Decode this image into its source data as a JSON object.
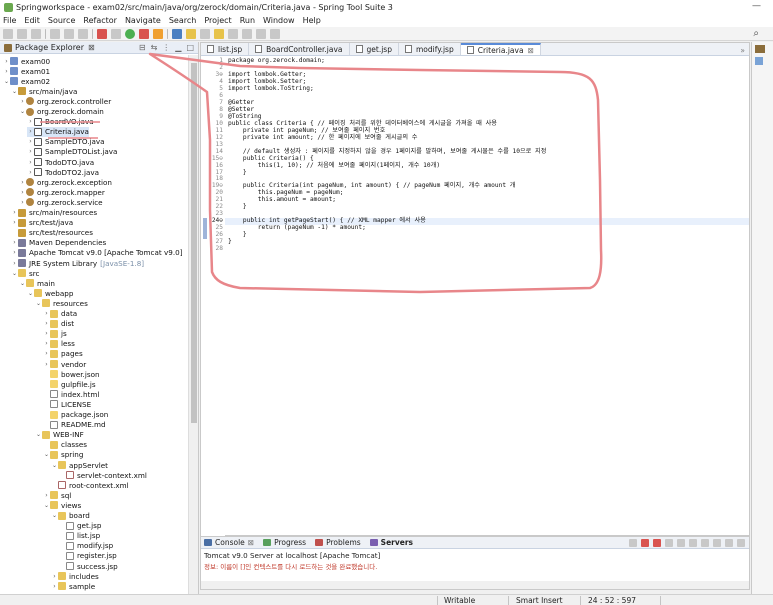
{
  "window": {
    "title": "Springworkspace - exam02/src/main/java/org/zerock/domain/Criteria.java - Spring Tool Suite 3",
    "minimize": "—"
  },
  "menu": [
    "File",
    "Edit",
    "Source",
    "Refactor",
    "Navigate",
    "Search",
    "Project",
    "Run",
    "Window",
    "Help"
  ],
  "package_explorer": {
    "title": "Package Explorer",
    "close": "⊠",
    "tree": [
      {
        "label": "exam00",
        "depth": 0,
        "icon": "project-icon",
        "arrow": "›"
      },
      {
        "label": "exam01",
        "depth": 0,
        "icon": "project-icon",
        "arrow": "›"
      },
      {
        "label": "exam02",
        "depth": 0,
        "icon": "project-icon",
        "arrow": "⌄"
      },
      {
        "label": "src/main/java",
        "depth": 1,
        "icon": "source-folder-icon",
        "arrow": "⌄"
      },
      {
        "label": "org.zerock.controller",
        "depth": 2,
        "icon": "package-icon",
        "arrow": "›"
      },
      {
        "label": "org.zerock.domain",
        "depth": 2,
        "icon": "package-icon",
        "arrow": "⌄"
      },
      {
        "label": "BoardVO.java",
        "depth": 3,
        "icon": "java-file-icon",
        "arrow": "›"
      },
      {
        "label": "Criteria.java",
        "depth": 3,
        "icon": "java-file-icon",
        "arrow": "›",
        "selected": true
      },
      {
        "label": "SampleDTO.java",
        "depth": 3,
        "icon": "java-file-icon",
        "arrow": "›"
      },
      {
        "label": "SampleDTOList.java",
        "depth": 3,
        "icon": "java-file-icon",
        "arrow": "›"
      },
      {
        "label": "TodoDTO.java",
        "depth": 3,
        "icon": "java-file-icon",
        "arrow": "›"
      },
      {
        "label": "TodoDTO2.java",
        "depth": 3,
        "icon": "java-file-icon",
        "arrow": "›"
      },
      {
        "label": "org.zerock.exception",
        "depth": 2,
        "icon": "package-icon",
        "arrow": "›"
      },
      {
        "label": "org.zerock.mapper",
        "depth": 2,
        "icon": "package-icon",
        "arrow": "›"
      },
      {
        "label": "org.zerock.service",
        "depth": 2,
        "icon": "package-icon",
        "arrow": "›"
      },
      {
        "label": "src/main/resources",
        "depth": 1,
        "icon": "source-folder-icon",
        "arrow": "›"
      },
      {
        "label": "src/test/java",
        "depth": 1,
        "icon": "source-folder-icon",
        "arrow": "›"
      },
      {
        "label": "src/test/resources",
        "depth": 1,
        "icon": "source-folder-icon",
        "arrow": ""
      },
      {
        "label": "Maven Dependencies",
        "depth": 1,
        "icon": "library-icon",
        "arrow": "›"
      },
      {
        "label": "Apache Tomcat v9.0 [Apache Tomcat v9.0]",
        "depth": 1,
        "icon": "library-icon",
        "arrow": "›"
      },
      {
        "label": "JRE System Library",
        "depth": 1,
        "icon": "library-icon",
        "arrow": "›",
        "suffix": "[JavaSE-1.8]"
      },
      {
        "label": "src",
        "depth": 1,
        "icon": "folder-icon",
        "arrow": "⌄"
      },
      {
        "label": "main",
        "depth": 2,
        "icon": "folder-icon",
        "arrow": "⌄"
      },
      {
        "label": "webapp",
        "depth": 3,
        "icon": "folder-icon",
        "arrow": "⌄"
      },
      {
        "label": "resources",
        "depth": 4,
        "icon": "folder-icon",
        "arrow": "⌄"
      },
      {
        "label": "data",
        "depth": 5,
        "icon": "folder-icon",
        "arrow": "›"
      },
      {
        "label": "dist",
        "depth": 5,
        "icon": "folder-icon",
        "arrow": "›"
      },
      {
        "label": "js",
        "depth": 5,
        "icon": "folder-icon",
        "arrow": "›"
      },
      {
        "label": "less",
        "depth": 5,
        "icon": "folder-icon",
        "arrow": "›"
      },
      {
        "label": "pages",
        "depth": 5,
        "icon": "folder-icon",
        "arrow": "›"
      },
      {
        "label": "vendor",
        "depth": 5,
        "icon": "folder-icon",
        "arrow": "›"
      },
      {
        "label": "bower.json",
        "depth": 5,
        "icon": "json-file-icon",
        "arrow": ""
      },
      {
        "label": "gulpfile.js",
        "depth": 5,
        "icon": "js-file-icon",
        "arrow": ""
      },
      {
        "label": "index.html",
        "depth": 5,
        "icon": "html-file-icon",
        "arrow": ""
      },
      {
        "label": "LICENSE",
        "depth": 5,
        "icon": "text-file-icon",
        "arrow": ""
      },
      {
        "label": "package.json",
        "depth": 5,
        "icon": "json-file-icon",
        "arrow": ""
      },
      {
        "label": "README.md",
        "depth": 5,
        "icon": "text-file-icon",
        "arrow": ""
      },
      {
        "label": "WEB-INF",
        "depth": 4,
        "icon": "folder-icon",
        "arrow": "⌄"
      },
      {
        "label": "classes",
        "depth": 5,
        "icon": "folder-icon",
        "arrow": ""
      },
      {
        "label": "spring",
        "depth": 5,
        "icon": "folder-icon",
        "arrow": "⌄"
      },
      {
        "label": "appServlet",
        "depth": 6,
        "icon": "folder-icon",
        "arrow": "⌄"
      },
      {
        "label": "servlet-context.xml",
        "depth": 7,
        "icon": "xml-file-icon",
        "arrow": ""
      },
      {
        "label": "root-context.xml",
        "depth": 6,
        "icon": "xml-file-icon",
        "arrow": ""
      },
      {
        "label": "sql",
        "depth": 5,
        "icon": "folder-icon",
        "arrow": "›"
      },
      {
        "label": "views",
        "depth": 5,
        "icon": "folder-icon",
        "arrow": "⌄"
      },
      {
        "label": "board",
        "depth": 6,
        "icon": "folder-icon",
        "arrow": "⌄"
      },
      {
        "label": "get.jsp",
        "depth": 7,
        "icon": "jsp-file-icon",
        "arrow": ""
      },
      {
        "label": "list.jsp",
        "depth": 7,
        "icon": "jsp-file-icon",
        "arrow": ""
      },
      {
        "label": "modify.jsp",
        "depth": 7,
        "icon": "jsp-file-icon",
        "arrow": ""
      },
      {
        "label": "register.jsp",
        "depth": 7,
        "icon": "jsp-file-icon",
        "arrow": ""
      },
      {
        "label": "success.jsp",
        "depth": 7,
        "icon": "jsp-file-icon",
        "arrow": ""
      },
      {
        "label": "includes",
        "depth": 6,
        "icon": "folder-icon",
        "arrow": "›"
      },
      {
        "label": "sample",
        "depth": 6,
        "icon": "folder-icon",
        "arrow": "›"
      }
    ]
  },
  "editor": {
    "tabs": [
      {
        "label": "list.jsp",
        "active": false
      },
      {
        "label": "BoardController.java",
        "active": false
      },
      {
        "label": "get.jsp",
        "active": false
      },
      {
        "label": "modify.jsp",
        "active": false
      },
      {
        "label": "Criteria.java",
        "active": true
      }
    ],
    "tab_close": "⊠",
    "tab_overflow": "»",
    "lines": [
      {
        "n": "1",
        "t": "package org.zerock.domain;"
      },
      {
        "n": "2",
        "t": ""
      },
      {
        "n": "3⊕",
        "t": "import lombok.Getter;"
      },
      {
        "n": "4",
        "t": "import lombok.Setter;"
      },
      {
        "n": "5",
        "t": "import lombok.ToString;"
      },
      {
        "n": "6",
        "t": ""
      },
      {
        "n": "7",
        "t": "@Getter"
      },
      {
        "n": "8",
        "t": "@Setter"
      },
      {
        "n": "9",
        "t": "@ToString"
      },
      {
        "n": "10",
        "t": "public class Criteria { // 페이징 처리를 위한 데이터베이스에 게시글을 가져올 때 사용"
      },
      {
        "n": "11",
        "t": "    private int pageNum; // 보여줄 페이지 번호"
      },
      {
        "n": "12",
        "t": "    private int amount; // 한 페이지에 보여줄 게시글의 수"
      },
      {
        "n": "13",
        "t": ""
      },
      {
        "n": "14",
        "t": "    // default 생성자 : 페이지를 지정하지 않을 경우 1페이지를 말하며, 보여줄 게시물은 수를 10으로 지정"
      },
      {
        "n": "15⊖",
        "t": "    public Criteria() {"
      },
      {
        "n": "16",
        "t": "        this(1, 10); // 처음에 보여줄 페이지(1페이지, 개수 10개)"
      },
      {
        "n": "17",
        "t": "    }"
      },
      {
        "n": "18",
        "t": ""
      },
      {
        "n": "19⊖",
        "t": "    public Criteria(int pageNum, int amount) { // pageNum 페이지, 개수 amount 개"
      },
      {
        "n": "20",
        "t": "        this.pageNum = pageNum;"
      },
      {
        "n": "21",
        "t": "        this.amount = amount;"
      },
      {
        "n": "22",
        "t": "    }"
      },
      {
        "n": "23",
        "t": ""
      },
      {
        "n": "24⊖",
        "t": "    public int getPageStart() { // XML mapper 에서 사용"
      },
      {
        "n": "25",
        "t": "        return (pageNum -1) * amount;"
      },
      {
        "n": "26",
        "t": "    }"
      },
      {
        "n": "27",
        "t": "}"
      },
      {
        "n": "28",
        "t": ""
      }
    ]
  },
  "console": {
    "tabs": [
      "Console",
      "Progress",
      "Problems",
      "Servers"
    ],
    "active_tab": "Servers",
    "close": "⊠",
    "server_line": "Tomcat v9.0 Server at localhost [Apache Tomcat]",
    "message": "정보: 이름이 []인 컨텍스트를 다시 로드하는 것을 완료했습니다."
  },
  "status_bar": {
    "mode": "Writable",
    "insert": "Smart Insert",
    "position": "24 : 52 : 597"
  },
  "toolbar": {
    "search_icon": "search-icon"
  }
}
